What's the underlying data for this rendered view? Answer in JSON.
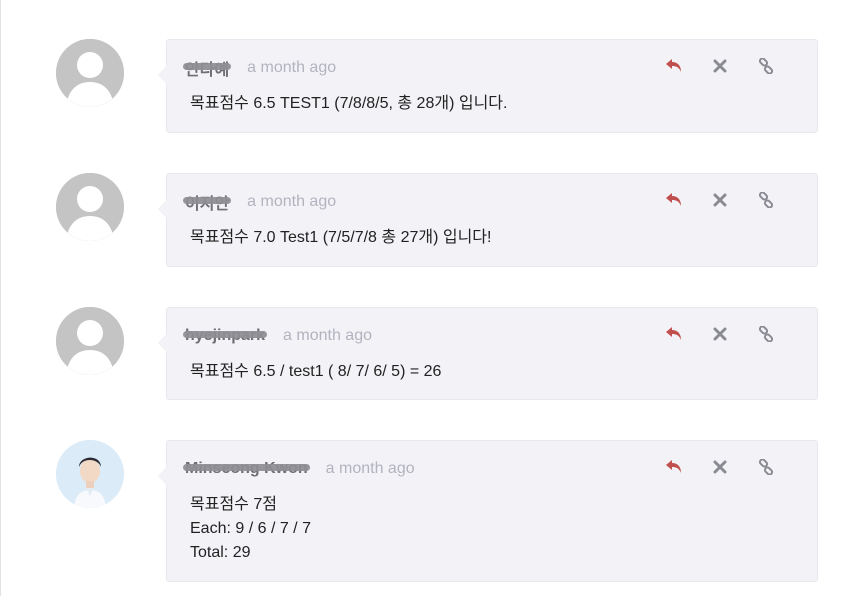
{
  "comments": [
    {
      "author": "안다예",
      "time": "a month ago",
      "avatar": "default-avatar",
      "lines": [
        "목표점수 6.5   TEST1 (7/8/8/5, 총 28개) 입니다."
      ]
    },
    {
      "author": "이지안",
      "time": "a month ago",
      "avatar": "default-avatar",
      "lines": [
        "목표점수 7.0 Test1 (7/5/7/8 총 27개) 입니다!"
      ]
    },
    {
      "author": "hyejinpark",
      "time": "a month ago",
      "avatar": "default-avatar",
      "lines": [
        "목표점수 6.5 / test1 ( 8/ 7/ 6/ 5) = 26"
      ]
    },
    {
      "author": "Minseong Kwon",
      "time": "a month ago",
      "avatar": "photo-avatar",
      "lines": [
        "목표점수 7점",
        "Each: 9 / 6 / 7 / 7",
        "Total: 29"
      ]
    }
  ],
  "icons": {
    "reply": "reply-icon",
    "delete": "close-icon",
    "permalink": "link-icon"
  },
  "colors": {
    "bubble_bg": "#f3f3f7",
    "reply_icon": "#c0504d",
    "muted_icon": "#8a8a93",
    "timestamp": "#b3b3bf"
  }
}
